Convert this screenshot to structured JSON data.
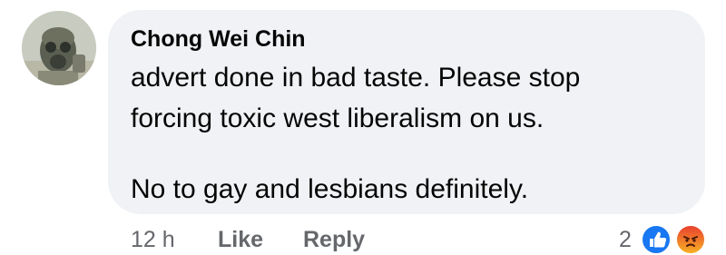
{
  "comment": {
    "author": "Chong Wei Chin",
    "lines": [
      "advert done in bad taste. Please stop",
      "forcing toxic west liberalism on us.",
      "No to gay and lesbians definitely."
    ],
    "timestamp": "12 h",
    "like_label": "Like",
    "reply_label": "Reply",
    "reaction_count": "2",
    "reactions": [
      "like-reaction-icon",
      "angry-reaction-icon"
    ]
  },
  "colors": {
    "bubble_bg": "#f0f2f5",
    "text": "#050505",
    "secondary_text": "#65676b",
    "like_blue": "#1877f2"
  }
}
